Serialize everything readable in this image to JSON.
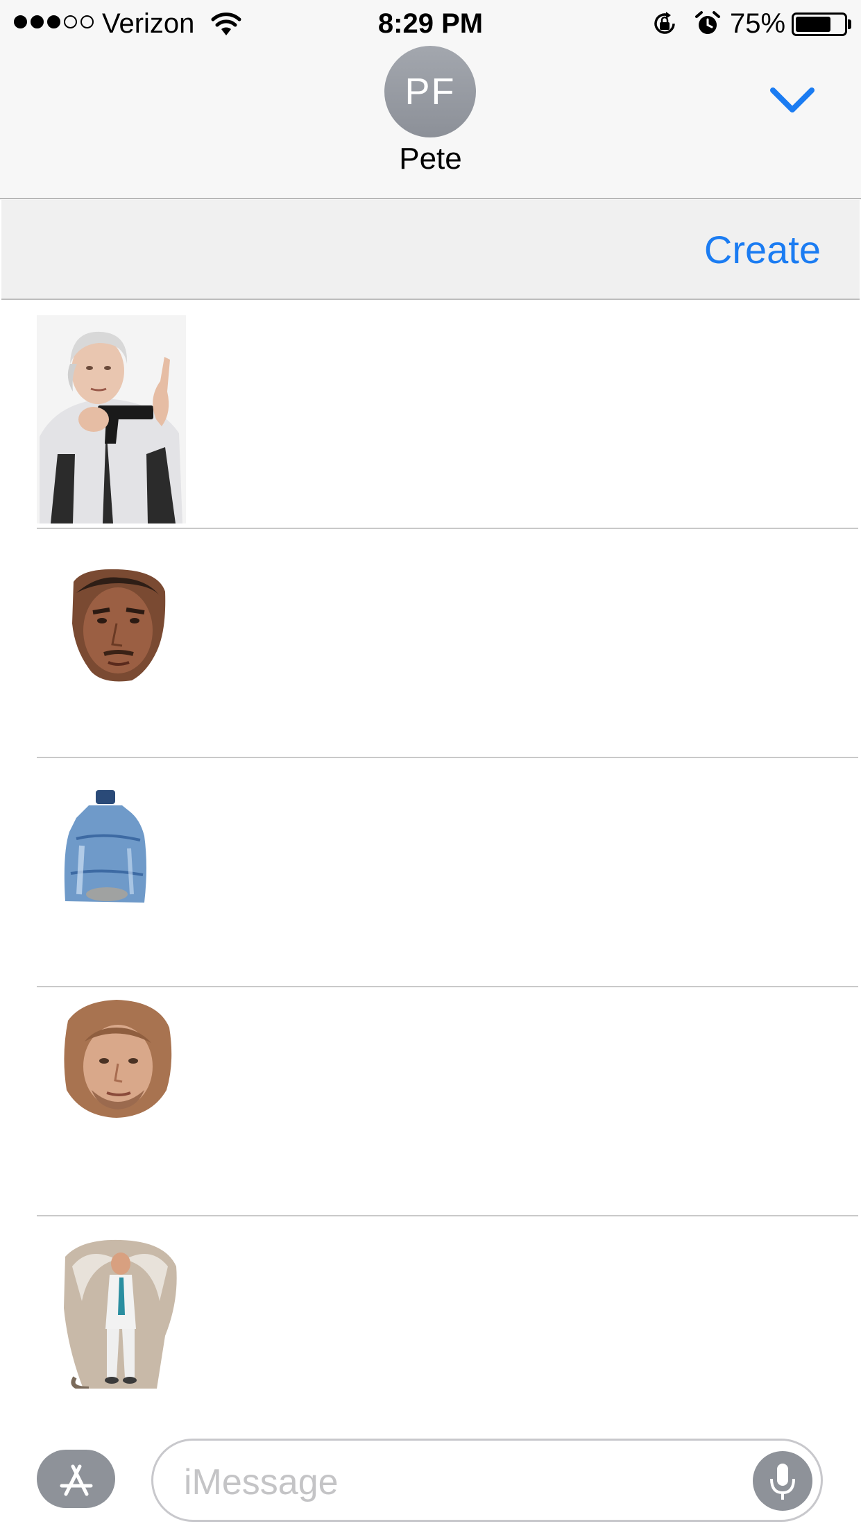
{
  "status_bar": {
    "signal_filled": 3,
    "signal_total": 5,
    "carrier": "Verizon",
    "time": "8:29 PM",
    "battery_percent": "75%",
    "battery_level": 0.75,
    "icons": [
      "wifi-icon",
      "rotation-lock-icon",
      "alarm-icon",
      "battery-icon"
    ]
  },
  "header": {
    "avatar_initials": "PF",
    "contact_name": "Pete",
    "collapse_icon": "chevron-down-icon"
  },
  "toolbar": {
    "create_label": "Create"
  },
  "stickers": [
    {
      "name": "grandma-with-gun"
    },
    {
      "name": "face-man-1"
    },
    {
      "name": "water-jug"
    },
    {
      "name": "face-man-long-hair"
    },
    {
      "name": "man-with-angel-wings"
    }
  ],
  "input": {
    "placeholder": "iMessage",
    "app_store_icon": "app-store-icon",
    "mic_icon": "microphone-icon"
  },
  "colors": {
    "accent": "#1b7cf2",
    "header_bg": "#f7f7f7",
    "toolbar_bg": "#f0f0f0",
    "avatar": "#9a9ea5",
    "icon_button": "#8e9299"
  }
}
